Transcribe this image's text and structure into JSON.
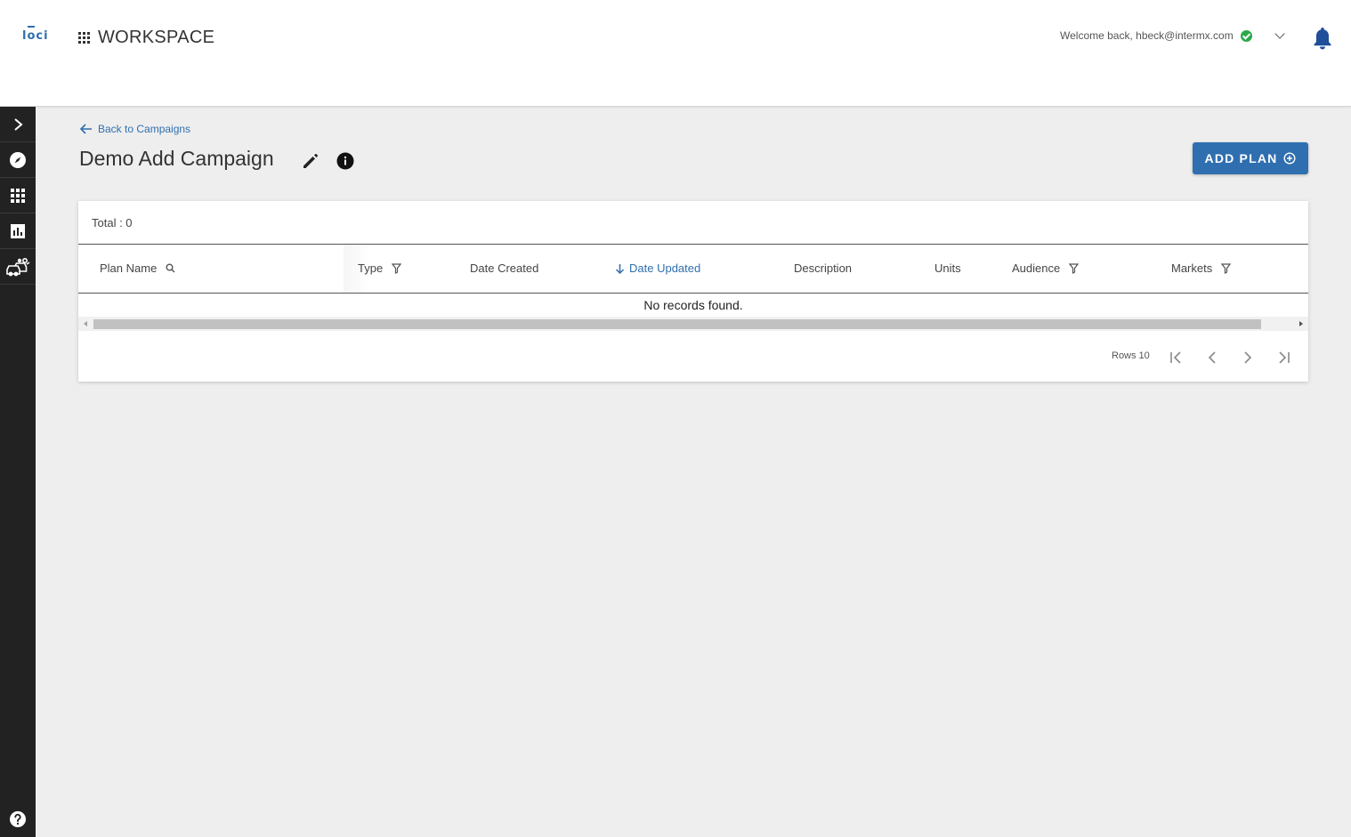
{
  "header": {
    "logo_text": "loci",
    "workspace_title": "WORKSPACE",
    "welcome_text": "Welcome back, hbeck@intermx.com",
    "icons": [
      "grid-icon",
      "check-circle-icon",
      "chevron-down-icon",
      "bell-icon"
    ]
  },
  "sidebar": {
    "items": [
      {
        "name": "expand",
        "icon": "chevron-right-icon"
      },
      {
        "name": "explore",
        "icon": "compass-icon"
      },
      {
        "name": "workspace",
        "icon": "grid-icon"
      },
      {
        "name": "reports",
        "icon": "bar-chart-icon"
      },
      {
        "name": "traffic",
        "icon": "cars-icon"
      }
    ],
    "help_icon": "help-icon"
  },
  "page": {
    "back_label": "Back to Campaigns",
    "title": "Demo Add Campaign",
    "add_plan_label": "ADD PLAN"
  },
  "table": {
    "total_label": "Total : 0",
    "columns": [
      {
        "label": "Plan Name",
        "icon": "search-icon"
      },
      {
        "label": "Type",
        "icon": "filter-icon"
      },
      {
        "label": "Date Created",
        "icon": ""
      },
      {
        "label": "Date Updated",
        "icon": "arrow-down-icon",
        "sorted": "desc"
      },
      {
        "label": "Description",
        "icon": ""
      },
      {
        "label": "Units",
        "icon": ""
      },
      {
        "label": "Audience",
        "icon": "filter-icon"
      },
      {
        "label": "Markets",
        "icon": "filter-icon"
      }
    ],
    "empty_message": "No records found.",
    "rows_label": "Rows 10"
  },
  "colors": {
    "primary": "#2f6fb0",
    "sidebar_bg": "#222222",
    "page_bg": "#eeeeee",
    "success": "#2ca84b"
  }
}
